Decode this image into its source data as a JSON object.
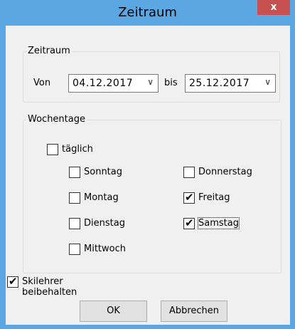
{
  "window": {
    "title": "Zeitraum",
    "close_label": "x"
  },
  "zeitraum_group": {
    "label": "Zeitraum",
    "from_label": "Von",
    "from_value": "04.12.2017",
    "to_label": "bis",
    "to_value": "25.12.2017"
  },
  "wochentage_group": {
    "label": "Wochentage",
    "daily": {
      "label": "täglich",
      "checked": false
    },
    "days": [
      {
        "label": "Sonntag",
        "checked": false
      },
      {
        "label": "Montag",
        "checked": false
      },
      {
        "label": "Dienstag",
        "checked": false
      },
      {
        "label": "Mittwoch",
        "checked": false
      },
      {
        "label": "Donnerstag",
        "checked": false
      },
      {
        "label": "Freitag",
        "checked": true
      },
      {
        "label": "Samstag",
        "checked": true
      }
    ]
  },
  "keep_instructor": {
    "label": "Skilehrer beibehalten",
    "checked": true
  },
  "buttons": {
    "ok": "OK",
    "cancel": "Abbrechen"
  },
  "icons": {
    "dropdown": "chevron-down-icon",
    "check": "checkmark-icon"
  }
}
